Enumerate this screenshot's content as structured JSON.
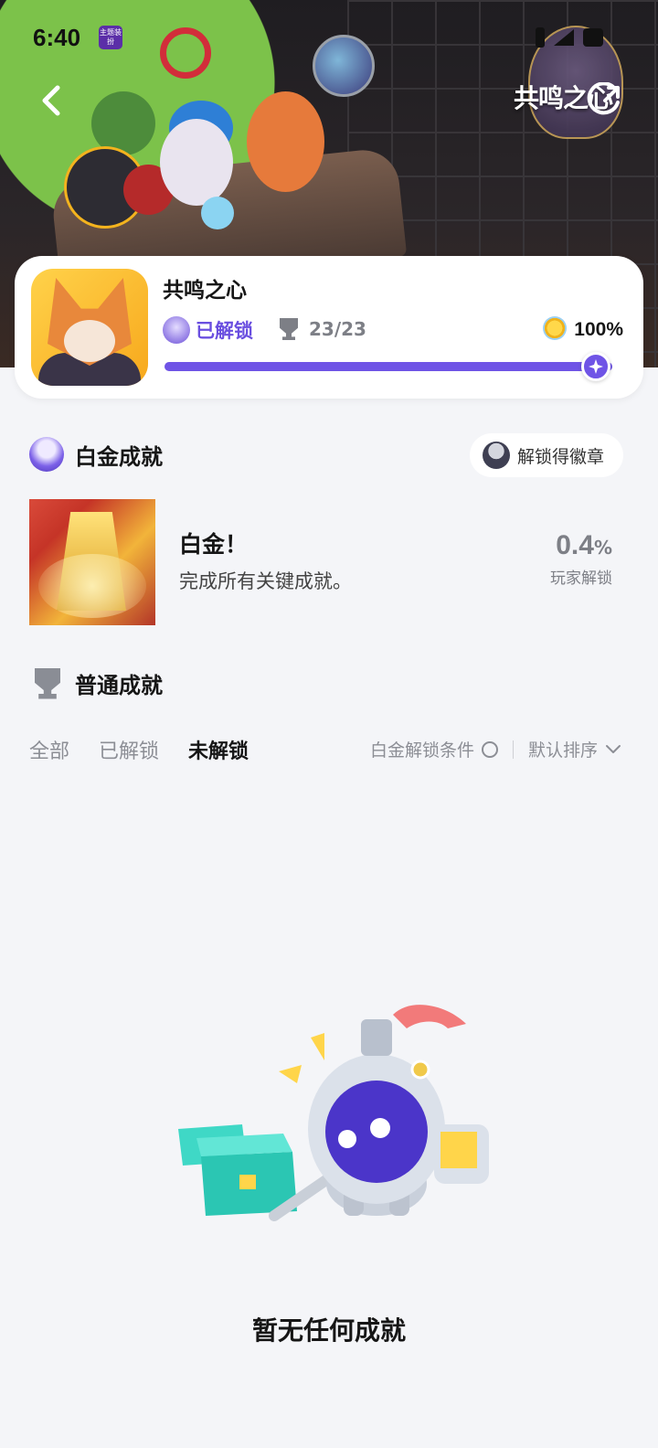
{
  "status_bar": {
    "time": "6:40",
    "badge_text": "主题装扮",
    "icons": [
      "bluetooth-icon",
      "signal-icon",
      "battery-icon"
    ]
  },
  "header": {
    "banner_title": "共鸣之心",
    "back_icon": "chevron-left-icon",
    "share_icon": "share-icon"
  },
  "game": {
    "title": "共鸣之心",
    "unlock_status": "已解锁",
    "trophy_count": "23/23",
    "completion": "100%",
    "progress_fraction": 1.0,
    "accent_color": "#6f54e6"
  },
  "platinum": {
    "section_title": "白金成就",
    "badge_button_label": "解锁得徽章",
    "achievement": {
      "name": "白金！",
      "description": "完成所有关键成就。",
      "rate_value": "0.4",
      "rate_unit": "%",
      "rate_label": "玩家解锁"
    }
  },
  "normal": {
    "section_title": "普通成就",
    "tabs": [
      {
        "label": "全部",
        "active": false
      },
      {
        "label": "已解锁",
        "active": false
      },
      {
        "label": "未解锁",
        "active": true
      }
    ],
    "filter_label": "白金解锁条件",
    "sort_label": "默认排序"
  },
  "empty_state": {
    "message": "暂无任何成就"
  }
}
